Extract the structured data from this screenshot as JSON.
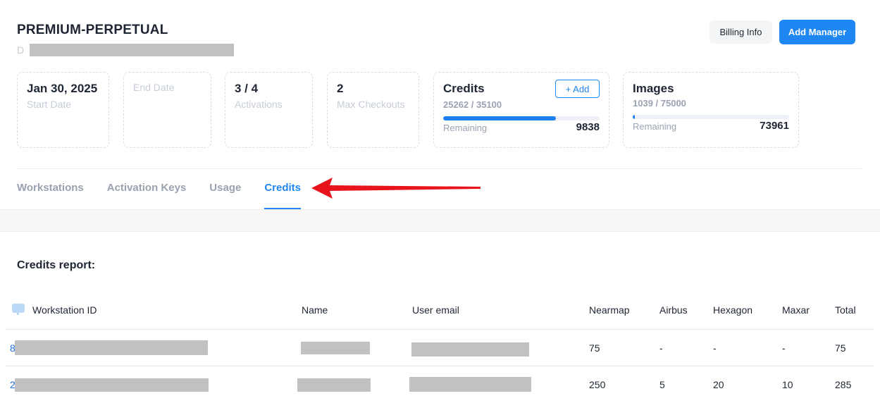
{
  "plan": {
    "title": "PREMIUM-PERPETUAL",
    "subtitle_initial": "D"
  },
  "actions": {
    "billing_label": "Billing Info",
    "manager_label": "Add Manager"
  },
  "stats": {
    "start": {
      "value": "Jan 30, 2025",
      "label": "Start Date"
    },
    "end": {
      "label": "End Date"
    },
    "activations": {
      "value": "3 / 4",
      "label": "Activations"
    },
    "checkouts": {
      "value": "2",
      "label": "Max Checkouts"
    },
    "credits": {
      "title": "Credits",
      "add_label": "+ Add",
      "usage": "25262 / 35100",
      "fraction_used": 0.72,
      "remaining_label": "Remaining",
      "remaining": "9838"
    },
    "images": {
      "title": "Images",
      "usage": "1039 / 75000",
      "fraction_used": 0.014,
      "remaining_label": "Remaining",
      "remaining": "73961"
    }
  },
  "tabs": [
    "Workstations",
    "Activation Keys",
    "Usage",
    "Credits"
  ],
  "active_tab": "Credits",
  "report": {
    "title": "Credits report:",
    "columns": [
      "Workstation ID",
      "Name",
      "User email",
      "Nearmap",
      "Airbus",
      "Hexagon",
      "Maxar",
      "Total"
    ],
    "rows": [
      {
        "id_prefix": "8",
        "nearmap": "75",
        "airbus": "-",
        "hexagon": "-",
        "maxar": "-",
        "total": "75"
      },
      {
        "id_prefix": "2",
        "nearmap": "250",
        "airbus": "5",
        "hexagon": "20",
        "maxar": "10",
        "total": "285"
      }
    ]
  },
  "colors": {
    "accent": "#1f87f2",
    "annotation_arrow": "#e8141b",
    "redaction": "#c1c1c1"
  },
  "icons": {
    "column_icon": "chat-bubble-icon",
    "annotation": "red-arrow-icon"
  }
}
